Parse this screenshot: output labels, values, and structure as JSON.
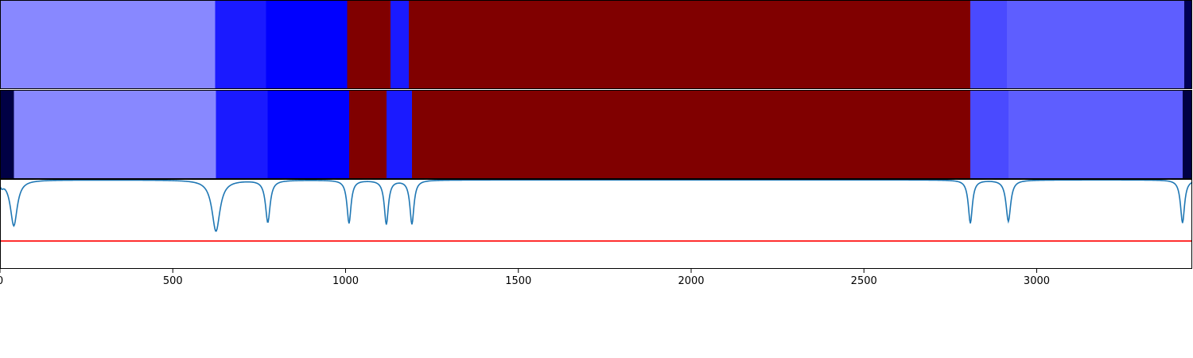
{
  "chart_data": [
    {
      "type": "heatmap",
      "name_hint": "segments-top",
      "xlim": [
        0,
        3450
      ],
      "segments": [
        {
          "start": 0,
          "end": 622,
          "color": "#8888ff"
        },
        {
          "start": 622,
          "end": 770,
          "color": "#1a1aff"
        },
        {
          "start": 770,
          "end": 1005,
          "color": "#0000ff"
        },
        {
          "start": 1005,
          "end": 1130,
          "color": "#800000"
        },
        {
          "start": 1130,
          "end": 1183,
          "color": "#1a1aff"
        },
        {
          "start": 1183,
          "end": 2808,
          "color": "#800000"
        },
        {
          "start": 2808,
          "end": 2914,
          "color": "#4a4aff"
        },
        {
          "start": 2914,
          "end": 3427,
          "color": "#5e5eff"
        },
        {
          "start": 3427,
          "end": 3450,
          "color": "#000055"
        }
      ]
    },
    {
      "type": "heatmap",
      "name_hint": "segments-bottom",
      "xlim": [
        0,
        3450
      ],
      "segments": [
        {
          "start": 0,
          "end": 40,
          "color": "#000044"
        },
        {
          "start": 40,
          "end": 625,
          "color": "#8888ff"
        },
        {
          "start": 625,
          "end": 775,
          "color": "#1a1aff"
        },
        {
          "start": 775,
          "end": 1010,
          "color": "#0000ff"
        },
        {
          "start": 1010,
          "end": 1118,
          "color": "#800000"
        },
        {
          "start": 1118,
          "end": 1192,
          "color": "#1a1aff"
        },
        {
          "start": 1192,
          "end": 2808,
          "color": "#800000"
        },
        {
          "start": 2808,
          "end": 2918,
          "color": "#4a4aff"
        },
        {
          "start": 2918,
          "end": 3422,
          "color": "#5e5eff"
        },
        {
          "start": 3422,
          "end": 3450,
          "color": "#000044"
        }
      ]
    },
    {
      "type": "line",
      "xlim": [
        0,
        3450
      ],
      "ylim": [
        0,
        1
      ],
      "x_ticks": [
        0,
        500,
        1000,
        1500,
        2000,
        2500,
        3000
      ],
      "x_tick_labels": [
        "0",
        "500",
        "1000",
        "1500",
        "2000",
        "2500",
        "3000"
      ],
      "threshold": {
        "value": 0.31,
        "color": "#ff0000"
      },
      "series": [
        {
          "color": "#1f77b4",
          "baseline": 0.99,
          "dips": [
            {
              "x": 5,
              "min": 0.94,
              "width": 6
            },
            {
              "x": 40,
              "min": 0.48,
              "width": 12
            },
            {
              "x": 625,
              "min": 0.42,
              "width": 14
            },
            {
              "x": 775,
              "min": 0.52,
              "width": 8
            },
            {
              "x": 1010,
              "min": 0.51,
              "width": 7
            },
            {
              "x": 1118,
              "min": 0.5,
              "width": 7
            },
            {
              "x": 1192,
              "min": 0.5,
              "width": 7
            },
            {
              "x": 2808,
              "min": 0.51,
              "width": 7
            },
            {
              "x": 2918,
              "min": 0.53,
              "width": 8
            },
            {
              "x": 3422,
              "min": 0.51,
              "width": 7
            }
          ]
        }
      ]
    }
  ]
}
